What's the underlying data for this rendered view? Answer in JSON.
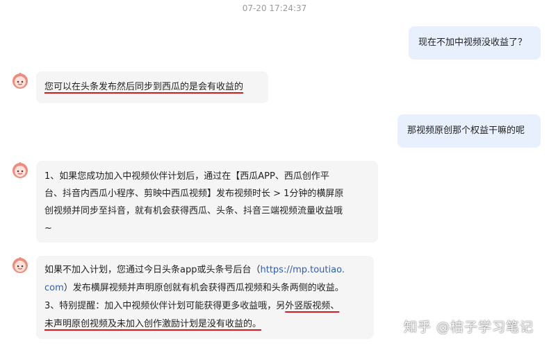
{
  "chat": {
    "timestamp": "07-20 17:24:37",
    "messages": [
      {
        "role": "user",
        "text": "现在不加中视频没收益了？"
      },
      {
        "role": "bot",
        "text": "您可以在头条发布然后同步到西瓜的是会有收益的"
      },
      {
        "role": "user",
        "text": "那视频原创那个权益干嘛的呢"
      },
      {
        "role": "bot",
        "lines": [
          "1、如果您成功加入中视频伙伴计划后，通过在【西瓜APP、西瓜创作平",
          "台、抖音内西瓜小程序、剪映中西瓜视频】发布视频时长 > 1分钟的横屏原",
          "创视频并同步至抖音，就有机会获得西瓜、头条、抖音三端视频流量收益哦",
          "~"
        ]
      },
      {
        "role": "bot",
        "parts": {
          "line1_text": "如果不加入计划，您通过今日头条app或头条号后台（",
          "link_a": "https://mp.toutiao.",
          "link_b": "com",
          "line2_text": "）发布横屏视频并声明原创就有机会获得西瓜视频和头条两侧的收益。",
          "line3_text": "3、特别提醒：加入中视频伙伴计划可能获得更多收益哦，另",
          "line3_emph": "外竖版视频、",
          "line4_emph": "未声明原创视频及未加入创作激励计划是没有收益的。"
        }
      }
    ]
  },
  "watermark": "知乎 @桔子学习笔记",
  "icons": {
    "avatar": "orange-robot-avatar-icon"
  },
  "colors": {
    "user_bubble": "#e8f0fd",
    "bot_bubble": "#f5f5f5",
    "underline": "#d7191f",
    "link": "#2f5db4"
  }
}
